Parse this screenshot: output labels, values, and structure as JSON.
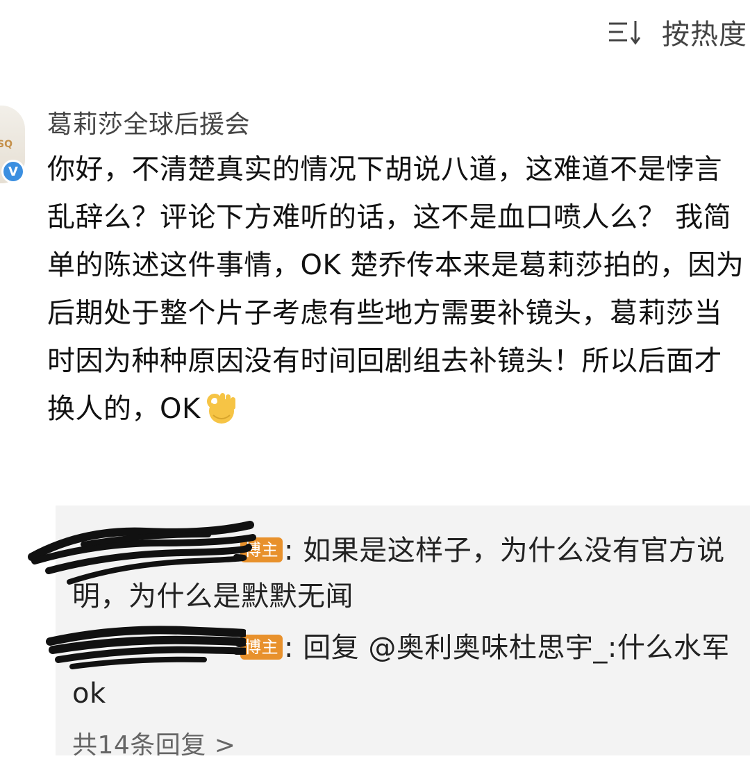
{
  "sort": {
    "icon": "sort-icon",
    "label": "按热度"
  },
  "comment": {
    "avatar_text": "SQ",
    "verified_badge": "V",
    "username": "葛莉莎全球后援会",
    "text": "你好，不清楚真实的情况下胡说八道，这难道不是悖言乱辞么？评论下方难听的话，这不是血口喷人么？ 我简单的陈述这件事情，OK    楚乔传本来是葛莉莎拍的，因为后期处于整个片子考虑有些地方需要补镜头，葛莉莎当时因为种种原因没有时间回剧组去补镜头！所以后面才换人的，OK",
    "emoji": "ok-hand-icon"
  },
  "replies": [
    {
      "author_badge": "博主",
      "text": "如果是这样子，为什么没有官方说明，为什么是默默无闻"
    },
    {
      "author_badge": "博主",
      "text": "回复 @奥利奥味杜思宇_:什么水军 ok"
    }
  ],
  "more_replies": "共14条回复 >",
  "colors": {
    "badge": "#e8912c",
    "reply_bg": "#f3f3f3",
    "verified": "#3b8fe0"
  }
}
